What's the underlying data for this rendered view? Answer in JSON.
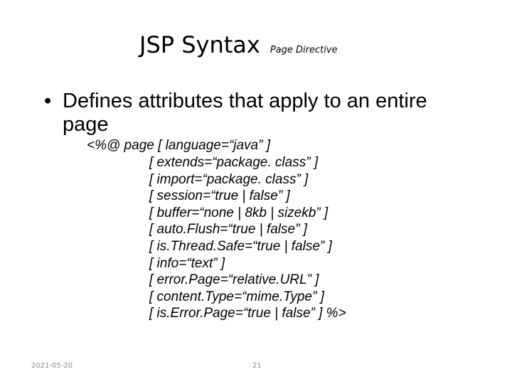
{
  "title": {
    "main": "JSP Syntax",
    "sub": "Page Directive"
  },
  "bullet": {
    "marker": "•",
    "text": "Defines attributes that apply to an entire page"
  },
  "code": {
    "first_line": "<%@ page  [ language=“java” ]",
    "lines": [
      "[ extends=“package. class” ]",
      "[ import=“package. class” ]",
      "[ session=“true | false” ]",
      "[ buffer=“none | 8kb | sizekb” ]",
      "[ auto.Flush=“true | false” ]",
      "[ is.Thread.Safe=“true | false” ]",
      "[ info=“text” ]",
      "[ error.Page=“relative.URL” ]",
      "[ content.Type=“mime.Type” ]",
      "[ is.Error.Page=“true | false” ]  %>"
    ]
  },
  "footer": {
    "date": "2021-05-20",
    "page": "21"
  }
}
